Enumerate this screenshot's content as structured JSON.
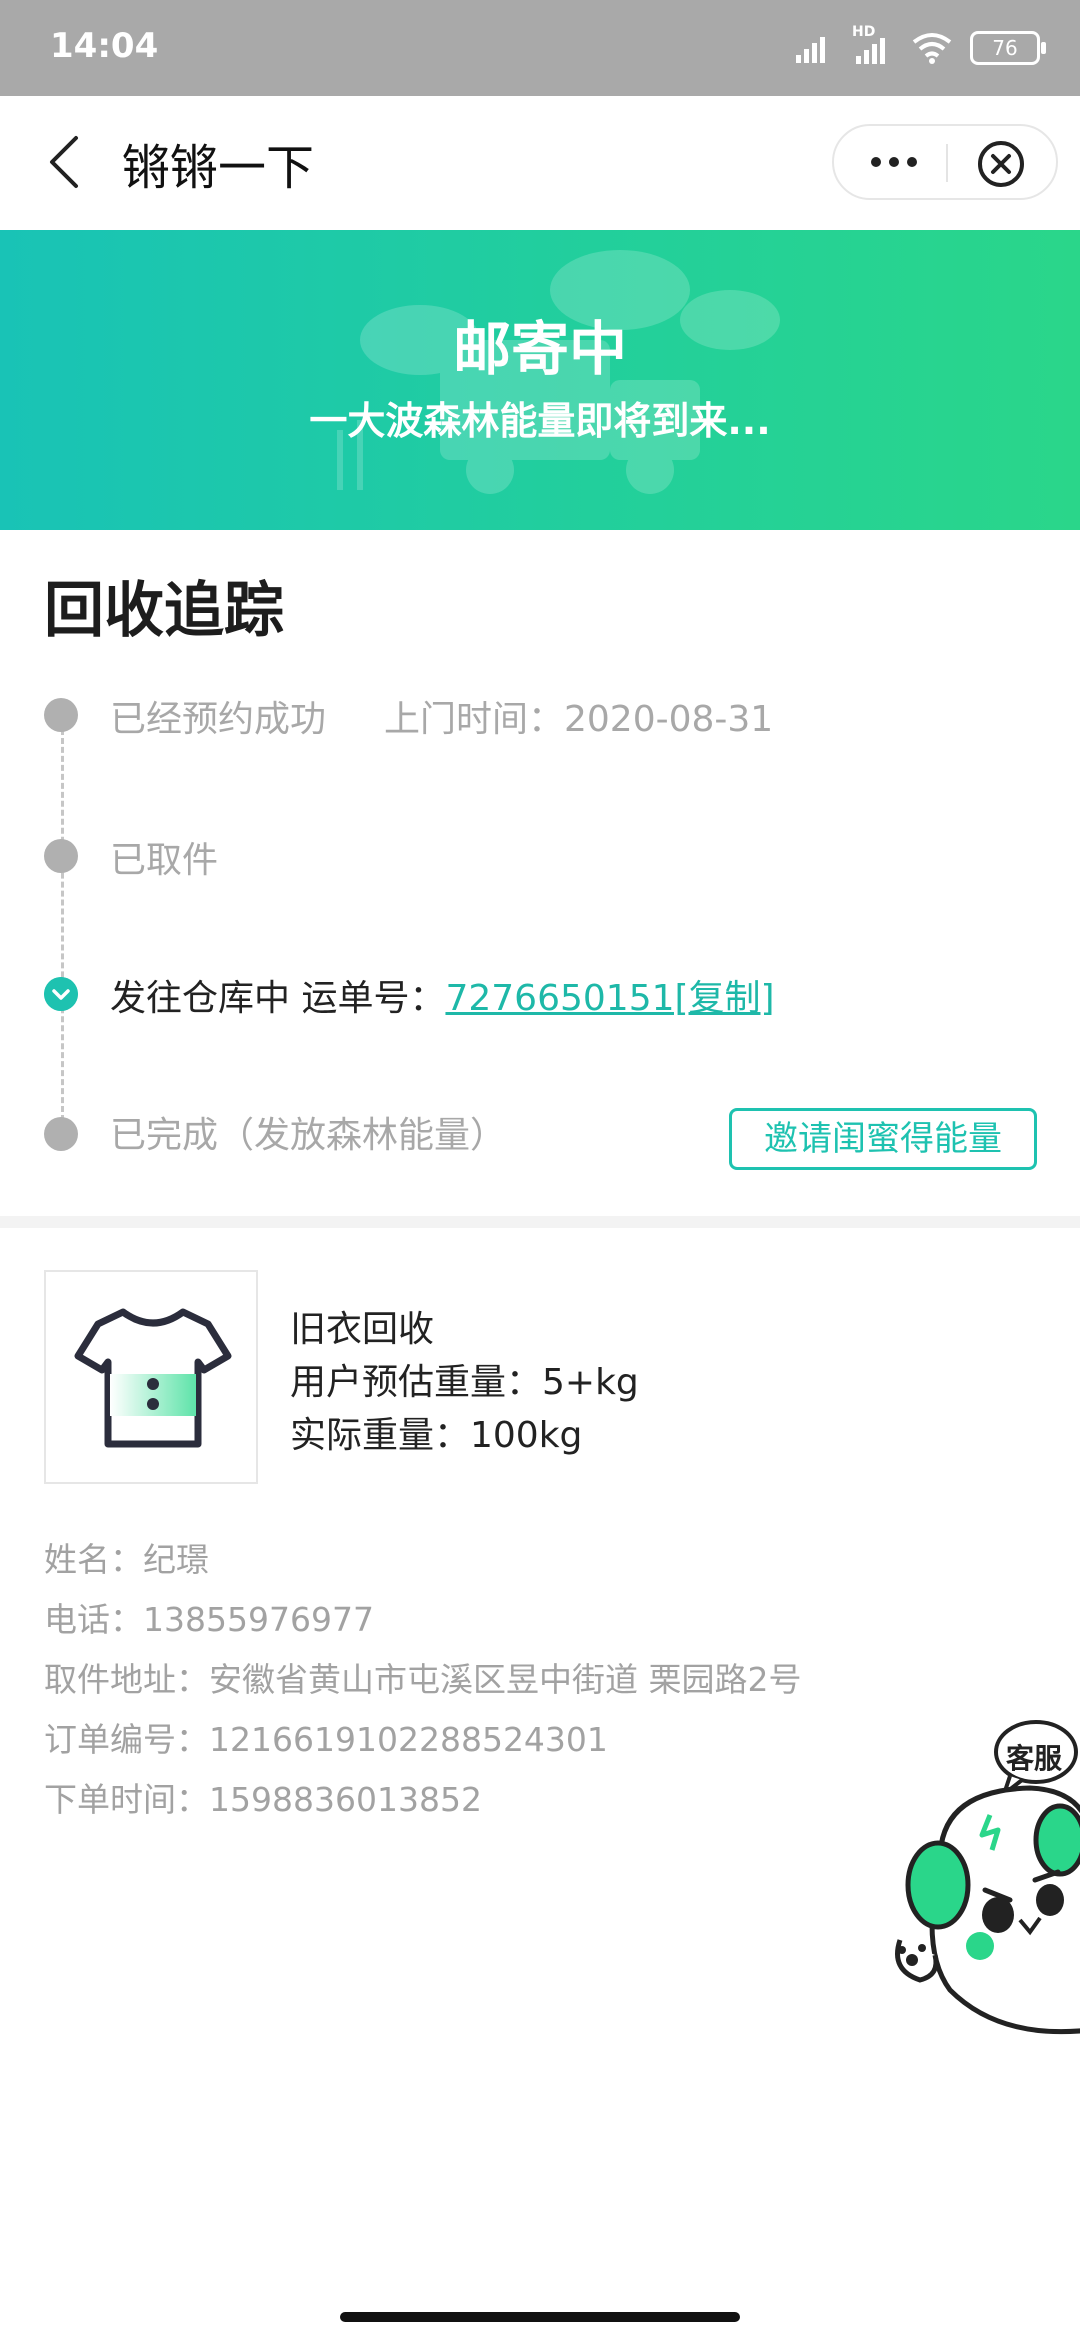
{
  "status_bar": {
    "time": "14:04",
    "battery": "76",
    "network_label": "HD"
  },
  "nav": {
    "title": "锵锵一下"
  },
  "banner": {
    "title": "邮寄中",
    "subtitle": "一大波森林能量即将到来..."
  },
  "tracking": {
    "title": "回收追踪",
    "steps": [
      {
        "label": "已经预约成功",
        "extra": "上门时间：2020-08-31",
        "state": "done"
      },
      {
        "label": "已取件",
        "state": "done"
      },
      {
        "label": "发往仓库中 运单号：",
        "waybill": "7276650151[复制]",
        "state": "current"
      },
      {
        "label": "已完成（发放森林能量）",
        "state": "pending"
      }
    ],
    "invite_button": "邀请闺蜜得能量"
  },
  "product": {
    "name": "旧衣回收",
    "estimate": "用户预估重量：5+kg",
    "actual": "实际重量：100kg",
    "icon": "tshirt-icon"
  },
  "order_info": {
    "name": "姓名：纪璟",
    "phone": "电话：13855976977",
    "address": "取件地址：安徽省黄山市屯溪区昱中街道 栗园路2号",
    "order_no": "订单编号：1216619102288524301",
    "order_time": "下单时间：1598836013852"
  },
  "customer_service": {
    "label": "客服"
  },
  "colors": {
    "accent": "#1ec2b0",
    "banner_start": "#19c3b6",
    "banner_end": "#2ad68a"
  }
}
